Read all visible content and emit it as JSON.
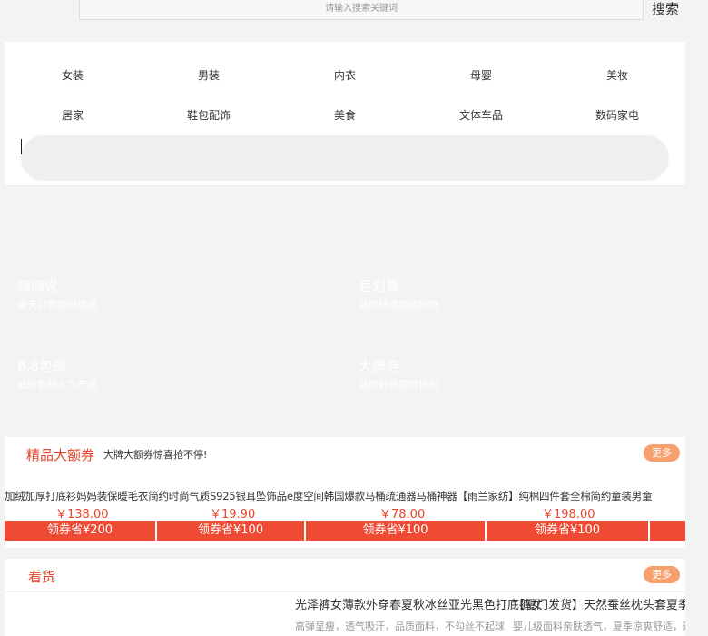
{
  "search": {
    "placeholder": "请输入搜索关键词",
    "button": "搜索"
  },
  "categories": [
    "女装",
    "男装",
    "内衣",
    "母婴",
    "美妆",
    "居家",
    "鞋包配饰",
    "美食",
    "文体车品",
    "数码家电"
  ],
  "features": [
    {
      "title": "嗨嗨说",
      "subtitle": "每天订购随时速递"
    },
    {
      "title": "巨划算",
      "subtitle": "品质精选超值好物"
    },
    {
      "title": "8.8包邮",
      "subtitle": "低价包邮人气产品"
    },
    {
      "title": "大牌券",
      "subtitle": "品牌好货限时折扣"
    }
  ],
  "coupon_section": {
    "title": "精品大额券",
    "subtitle": "大牌大额券惊喜抢不停!",
    "more": "更多",
    "titles_line": "加绒加厚打底衫妈妈装保暖毛衣简约时尚气质S925银耳坠饰品e度空间韩国爆款马桶疏通器马桶神器【雨兰家纺】纯棉四件套全棉简约童装男童",
    "products": [
      {
        "price": "￥138.00",
        "coupon": "领券省¥200"
      },
      {
        "price": "￥19.90",
        "coupon": "领券省¥100"
      },
      {
        "price": "￥78.00",
        "coupon": "领券省¥100"
      },
      {
        "price": "￥198.00",
        "coupon": "领券省¥100"
      }
    ]
  },
  "watch_section": {
    "title": "看货",
    "more": "更多",
    "items": [
      {
        "title": "光泽裤女薄款外穿春夏秋冰丝亚光黑色打底裤女",
        "desc": "高弹显瘦，透气吸汗，品质面料，不勾丝不起球"
      },
      {
        "title": "【厦门发货】天然蚕丝枕头套夏季真丝枕巾",
        "desc": "婴儿级面料亲肤透气，夏季凉爽舒适，还能美容养颜呢？鸿星尔克"
      }
    ]
  }
}
